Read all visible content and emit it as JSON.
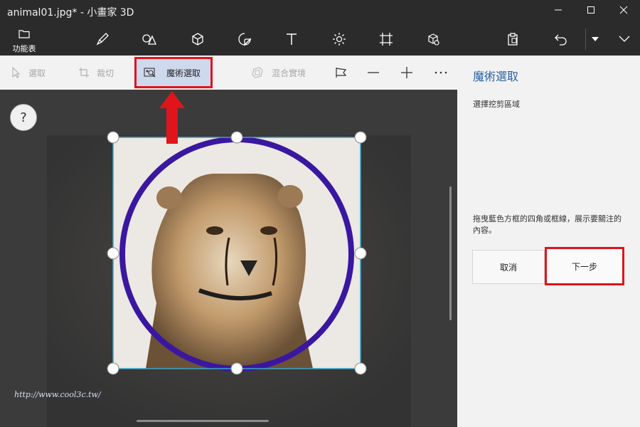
{
  "window": {
    "title": "animal01.jpg* - 小畫家 3D"
  },
  "toolbar": {
    "menu_label": "功能表",
    "tools": [
      "brush-icon",
      "shapes-2d-icon",
      "shapes-3d-icon",
      "stickers-icon",
      "text-icon",
      "effects-icon",
      "canvas-icon",
      "library-3d-icon"
    ],
    "paste_icon": "paste-icon",
    "undo_icon": "undo-icon"
  },
  "subbar": {
    "select_label": "選取",
    "crop_label": "裁切",
    "magic_select_label": "魔術選取",
    "mix_reality_label": "混合實境"
  },
  "panel": {
    "title": "魔術選取",
    "subtitle": "選擇挖剪區域",
    "description": "拖曳藍色方框的四角或框線，展示要關注的內容。",
    "cancel_label": "取消",
    "next_label": "下一步"
  },
  "help": {
    "label": "?"
  },
  "watermark": "http://www.cool3c.tw/"
}
